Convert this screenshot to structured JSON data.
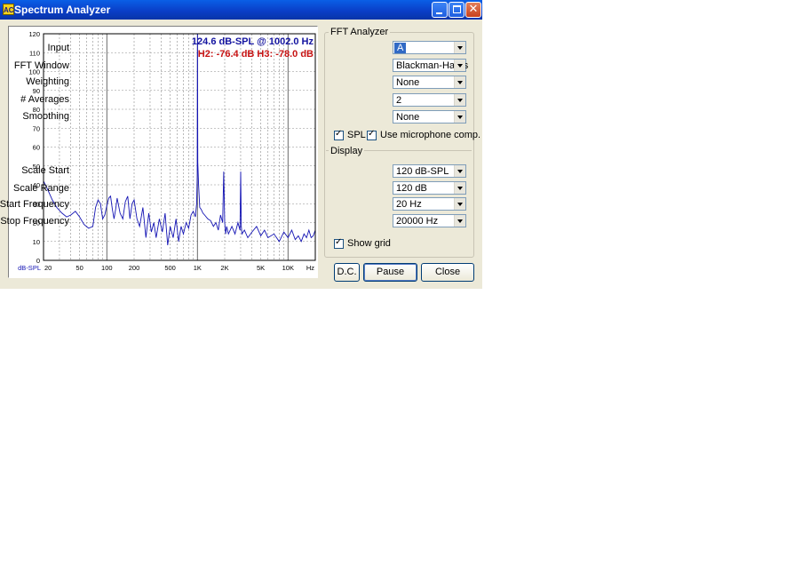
{
  "window": {
    "title": "Spectrum Analyzer",
    "icon_text": "AC"
  },
  "plot": {
    "readout": "124.6 dB-SPL @ 1002.0 Hz",
    "harmonics": "H2: -76.4 dB  H3: -78.0 dB",
    "y_ticks": [
      "120",
      "110",
      "100",
      "90",
      "80",
      "70",
      "60",
      "50",
      "40",
      "30",
      "20",
      "10",
      "0"
    ],
    "y_unit": "dB-SPL",
    "x_ticks": [
      "20",
      "50",
      "100",
      "200",
      "500",
      "1K",
      "2K",
      "5K",
      "10K"
    ],
    "x_unit": "Hz",
    "colors": {
      "trace": "#1414b4",
      "readout": "#1414a0",
      "harmonics": "#c81414",
      "grid": "#8c8c8c"
    }
  },
  "fft": {
    "legend": "FFT Analyzer",
    "input_label": "Input",
    "input_value": "A",
    "window_label": "FFT Window",
    "window_value": "Blackman-Harris",
    "weighting_label": "Weighting",
    "weighting_value": "None",
    "averages_label": "# Averages",
    "averages_value": "2",
    "smoothing_label": "Smoothing",
    "smoothing_value": "None",
    "spl_label": "SPL",
    "spl_checked": true,
    "mic_label": "Use microphone comp.",
    "mic_checked": true
  },
  "display": {
    "legend": "Display",
    "scale_start_label": "Scale Start",
    "scale_start_value": "120 dB-SPL",
    "scale_range_label": "Scale Range",
    "scale_range_value": "120 dB",
    "start_freq_label": "Start Frequency",
    "start_freq_value": "20 Hz",
    "stop_freq_label": "Stop Frequency",
    "stop_freq_value": "20000 Hz",
    "show_grid_label": "Show grid",
    "show_grid_checked": true
  },
  "buttons": {
    "dc": "D.C.",
    "pause": "Pause",
    "close": "Close"
  },
  "chart_data": {
    "type": "line",
    "title": "",
    "xlabel": "Hz",
    "ylabel": "dB-SPL",
    "x_scale": "log",
    "xlim": [
      20,
      20000
    ],
    "ylim": [
      0,
      120
    ],
    "grid": true,
    "series": [
      {
        "x": [
          20,
          22,
          25,
          28,
          32,
          36,
          40,
          45,
          50,
          56,
          63,
          70,
          75,
          80,
          85,
          90,
          95,
          100,
          105,
          110,
          115,
          120,
          125,
          130,
          140,
          150,
          160,
          170,
          180,
          190,
          200,
          215,
          230,
          250,
          270,
          290,
          310,
          330,
          350,
          380,
          410,
          440,
          470,
          500,
          540,
          580,
          620,
          660,
          700,
          750,
          800,
          850,
          900,
          950,
          980,
          995,
          1000,
          1002,
          1005,
          1010,
          1030,
          1060,
          1100,
          1150,
          1200,
          1300,
          1400,
          1500,
          1600,
          1700,
          1800,
          1900,
          1950,
          2000,
          2050,
          2100,
          2200,
          2400,
          2600,
          2800,
          2950,
          3000,
          3050,
          3100,
          3300,
          3600,
          4000,
          4500,
          5000,
          5500,
          6000,
          7000,
          8000,
          9000,
          10000,
          11000,
          12000,
          13000,
          14000,
          15000,
          16000,
          17000,
          18000,
          19000,
          20000
        ],
        "y": [
          42,
          38,
          32,
          28,
          25,
          23,
          24,
          26,
          23,
          19,
          17,
          18,
          28,
          32,
          30,
          22,
          24,
          29,
          33,
          34,
          27,
          22,
          27,
          33,
          25,
          22,
          31,
          34,
          22,
          30,
          32,
          22,
          18,
          28,
          12,
          25,
          15,
          20,
          12,
          22,
          15,
          25,
          8,
          18,
          12,
          22,
          10,
          18,
          14,
          20,
          17,
          24,
          26,
          23,
          30,
          45,
          110,
          124.6,
          95,
          52,
          40,
          28,
          27,
          25,
          24,
          22,
          21,
          18,
          20,
          16,
          24,
          20,
          47,
          20,
          14,
          18,
          14,
          18,
          14,
          20,
          16,
          47,
          18,
          14,
          16,
          12,
          15,
          18,
          13,
          16,
          12,
          14,
          10,
          15,
          12,
          16,
          11,
          13,
          10,
          14,
          12,
          16,
          12,
          13,
          16
        ]
      }
    ]
  }
}
